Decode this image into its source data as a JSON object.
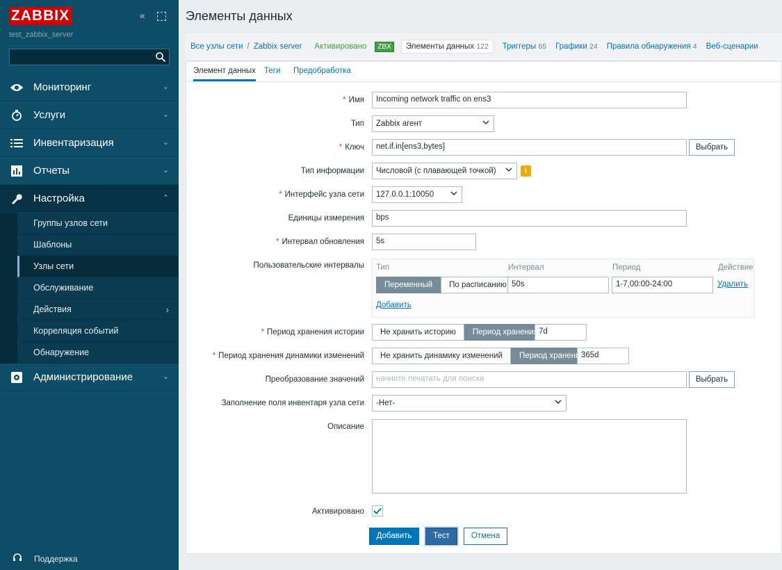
{
  "sidebar": {
    "logo": "ZABBIX",
    "server_name": "test_zabbix_server",
    "search_placeholder": "",
    "menu": [
      {
        "label": "Мониторинг",
        "icon": "eye-icon"
      },
      {
        "label": "Услуги",
        "icon": "clock-icon"
      },
      {
        "label": "Инвентаризация",
        "icon": "list-icon"
      },
      {
        "label": "Отчеты",
        "icon": "chart-icon"
      },
      {
        "label": "Настройка",
        "icon": "wrench-icon"
      },
      {
        "label": "Администрирование",
        "icon": "gear-icon"
      }
    ],
    "submenu": [
      {
        "label": "Группы узлов сети"
      },
      {
        "label": "Шаблоны"
      },
      {
        "label": "Узлы сети"
      },
      {
        "label": "Обслуживание"
      },
      {
        "label": "Действия"
      },
      {
        "label": "Корреляция событий"
      },
      {
        "label": "Обнаружение"
      }
    ],
    "support": "Поддержка"
  },
  "header": {
    "title": "Элементы данных"
  },
  "breadcrumbs": {
    "all_hosts": "Все узлы сети",
    "separator": "/",
    "host": "Zabbix server",
    "status": "Активировано",
    "zbx": "ZBX",
    "items": {
      "label": "Элементы данных",
      "count": "122"
    },
    "triggers": {
      "label": "Триггеры",
      "count": "65"
    },
    "graphs": {
      "label": "Графики",
      "count": "24"
    },
    "discovery": {
      "label": "Правила обнаружения",
      "count": "4"
    },
    "web": "Веб-сценарии"
  },
  "subtabs": [
    "Элемент данных",
    "Теги",
    "Предобработка"
  ],
  "form": {
    "name_label": "Имя",
    "name_value": "Incoming network traffic on ens3",
    "type_label": "Тип",
    "type_value": "Zabbix агент",
    "key_label": "Ключ",
    "key_value": "net.if.in[ens3,bytes]",
    "select_button": "Выбрать",
    "info_type_label": "Тип информации",
    "info_type_value": "Числовой (с плавающей точкой)",
    "info_badge": "i",
    "interface_label": "Интерфейс узла сети",
    "interface_value": "127.0.0.1:10050",
    "units_label": "Единицы измерения",
    "units_value": "bps",
    "interval_label": "Интервал обновления",
    "interval_value": "5s",
    "custom_label": "Пользовательские интервалы",
    "custom_headers": {
      "type": "Тип",
      "interval": "Интервал",
      "period": "Период",
      "action": "Действие"
    },
    "custom_row": {
      "flexible": "Переменный",
      "scheduling": "По расписанию",
      "interval": "50s",
      "period": "1-7,00:00-24:00",
      "remove": "Удалить"
    },
    "add_link": "Добавить",
    "history_label": "Период хранения истории",
    "history_no": "Не хранить историю",
    "history_yes": "Период хранения",
    "history_value": "7d",
    "trends_label": "Период хранения динамики изменений",
    "trends_no": "Не хранить динамику изменений",
    "trends_yes": "Период хранения",
    "trends_value": "365d",
    "valuemap_label": "Преобразование значений",
    "valuemap_placeholder": "начните печатать для поиска",
    "inventory_label": "Заполнение поля инвентаря узла сети",
    "inventory_value": "-Нет-",
    "description_label": "Описание",
    "enabled_label": "Активировано",
    "enabled": true
  },
  "actions": {
    "add": "Добавить",
    "test": "Тест",
    "cancel": "Отмена"
  },
  "colors": {
    "sidebar": "#0e4d68",
    "logo": "#d40000",
    "link": "#0275b8",
    "required": "#e33734",
    "status_green": "#429e47"
  }
}
